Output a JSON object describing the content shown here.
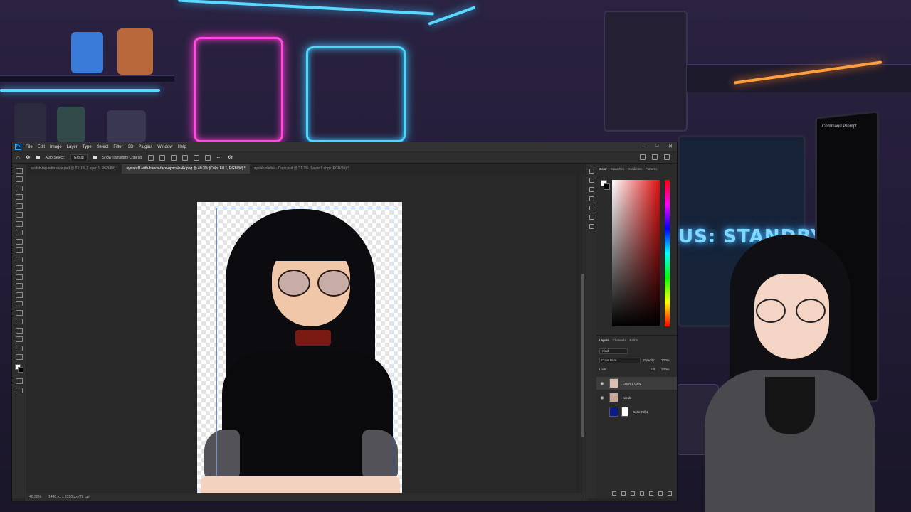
{
  "stream": {
    "status_text": "US: STANDBY",
    "terminal_title": "Command Prompt"
  },
  "photoshop": {
    "menus": [
      "File",
      "Edit",
      "Image",
      "Layer",
      "Type",
      "Select",
      "Filter",
      "3D",
      "Plugins",
      "Window",
      "Help"
    ],
    "options": {
      "auto_select": "Auto-Select:",
      "group": "Group",
      "show_transform": "Show Transform Controls"
    },
    "tabs": [
      "ayslab-big-reference.psd @ 52.1% (Layer 5, RGB/8#) *",
      "ayslab-f1-with-hands-face-upscale-4x.png @ 40.3% (Color Fill 1, RGB/8#) *",
      "ayslab-stellar - Copy.psd @ 31.3% (Layer 1 copy, RGB/8#) *"
    ],
    "active_tab_index": 1,
    "status": {
      "zoom": "40.33%",
      "dimensions": "1440 px x 2220 px (72 ppi)"
    },
    "color_panel": {
      "tabs": [
        "Color",
        "Swatches",
        "Gradients",
        "Patterns"
      ],
      "foreground": "#ffffff",
      "background": "#000000"
    },
    "layers_panel": {
      "tabs": [
        "Layers",
        "Channels",
        "Paths"
      ],
      "kind_label": "Kind",
      "blend_mode": "Color Burn",
      "opacity_label": "Opacity:",
      "opacity_value": "100%",
      "lock_label": "Lock:",
      "fill_label": "Fill:",
      "fill_value": "100%",
      "layers": [
        {
          "name": "Layer 1 copy",
          "visible": true,
          "selected": true
        },
        {
          "name": "hands",
          "visible": true,
          "selected": false
        },
        {
          "name": "Color Fill 1",
          "visible": false,
          "selected": false
        }
      ]
    }
  }
}
